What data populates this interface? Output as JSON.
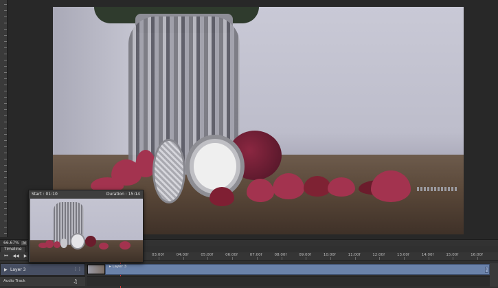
{
  "canvas": {
    "zoom": "66.67%"
  },
  "preview": {
    "start": "Start : 01:10",
    "duration": "Duration : 15:14"
  },
  "timeline": {
    "tab_label": "Timeline",
    "ruler_ticks": [
      "03:00f",
      "04:00f",
      "05:00f",
      "06:00f",
      "07:00f",
      "08:00f",
      "09:00f",
      "10:00f",
      "11:00f",
      "12:00f",
      "13:00f",
      "14:00f",
      "15:00f",
      "16:00f"
    ],
    "controls": {
      "first_frame": "⏮",
      "prev_frame": "◀◀",
      "play": "▶"
    },
    "layer": {
      "name": "Layer 3",
      "clip_name": "Layer 3"
    },
    "audio_track_label": "Audio Track"
  },
  "icons": {
    "playhead_color": "#d63a3a",
    "clip_color": "#6a82aa"
  }
}
